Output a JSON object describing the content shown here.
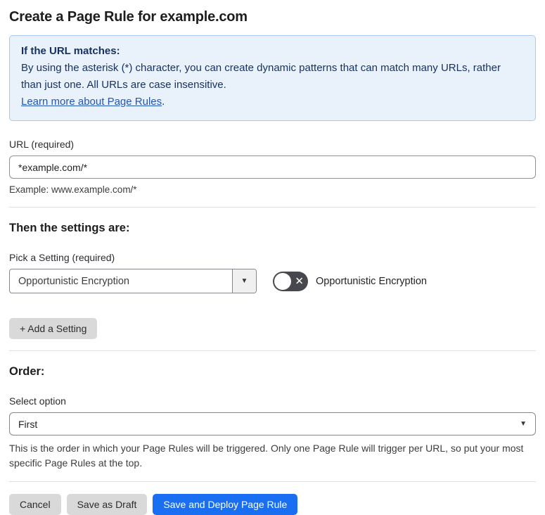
{
  "page": {
    "title": "Create a Page Rule for example.com"
  },
  "info_box": {
    "heading": "If the URL matches:",
    "body": "By using the asterisk (*) character, you can create dynamic patterns that can match many URLs, rather than just one. All URLs are case insensitive.",
    "link_label": "Learn more about Page Rules",
    "link_suffix": "."
  },
  "url_field": {
    "label": "URL (required)",
    "value": "*example.com/*",
    "example": "Example: www.example.com/*"
  },
  "settings": {
    "heading": "Then the settings are:",
    "pick_label": "Pick a Setting (required)",
    "selected_setting": "Opportunistic Encryption",
    "dropdown_caret_icon": "▼",
    "toggle_state": "off",
    "toggle_x_icon": "✕",
    "toggle_label": "Opportunistic Encryption",
    "add_button_label": "+ Add a Setting"
  },
  "order": {
    "heading": "Order:",
    "select_label": "Select option",
    "selected_option": "First",
    "select_caret_icon": "▼",
    "help_text": "This is the order in which your Page Rules will be triggered. Only one Page Rule will trigger per URL, so put your most specific Page Rules at the top."
  },
  "actions": {
    "cancel_label": "Cancel",
    "save_draft_label": "Save as Draft",
    "deploy_label": "Save and Deploy Page Rule"
  },
  "colors": {
    "info_bg": "#e9f1fb",
    "info_border": "#a9c9ef",
    "info_text": "#16315f",
    "link": "#2456b3",
    "primary_button": "#1a6ef2",
    "secondary_button": "#d9d9d9",
    "toggle_bg": "#47484d"
  }
}
